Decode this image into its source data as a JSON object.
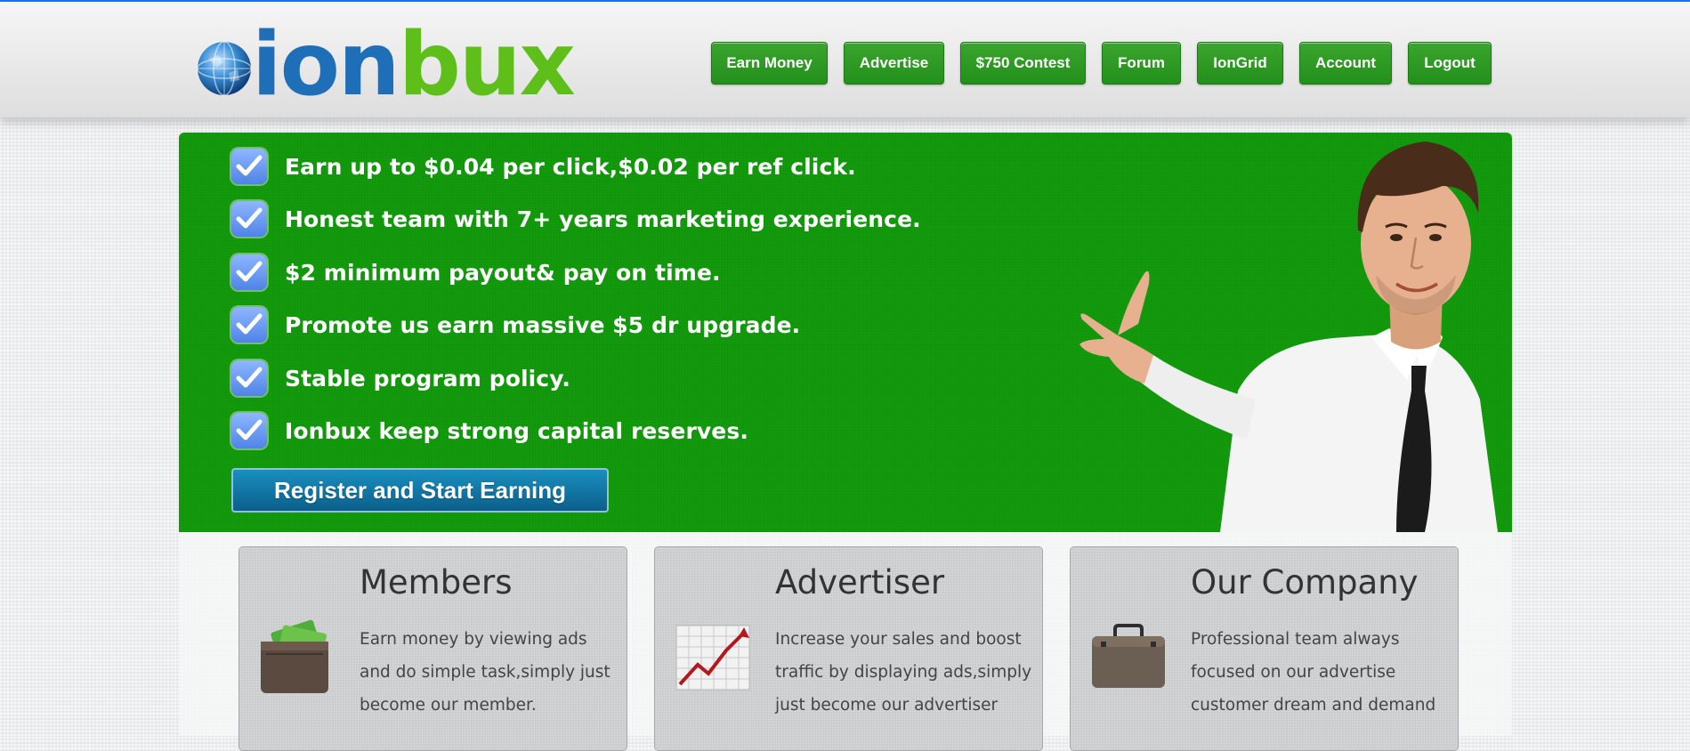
{
  "header": {
    "logo": {
      "part1": "ion",
      "part2": "bux"
    },
    "nav": [
      {
        "label": "Earn Money"
      },
      {
        "label": "Advertise"
      },
      {
        "label": "$750 Contest"
      },
      {
        "label": "Forum"
      },
      {
        "label": "IonGrid"
      },
      {
        "label": "Account"
      },
      {
        "label": "Logout"
      }
    ]
  },
  "hero": {
    "features": [
      "Earn up to $0.04 per click,$0.02 per ref click.",
      "Honest team with 7+ years marketing experience.",
      "$2 minimum payout& pay on time.",
      "Promote us earn massive $5 dr upgrade.",
      "Stable program policy.",
      "Ionbux keep strong capital reserves."
    ],
    "register_label": "Register and Start Earning"
  },
  "cards": [
    {
      "title": "Members",
      "text": "Earn money by viewing ads and do simple task,simply just become our member.",
      "icon": "wallet-icon"
    },
    {
      "title": "Advertiser",
      "text": "Increase your sales and boost traffic by displaying ads,simply just become our advertiser",
      "icon": "growth-chart-icon"
    },
    {
      "title": "Our Company",
      "text": "Professional team always focused on our advertise customer dream and demand",
      "icon": "briefcase-icon"
    }
  ],
  "colors": {
    "accent_blue": "#1a73e8",
    "nav_green": "#2a9b22",
    "hero_green": "#139a0d",
    "register_blue": "#0e77a8",
    "logo_blue": "#1f6fb8",
    "logo_green": "#5fbf1a"
  }
}
